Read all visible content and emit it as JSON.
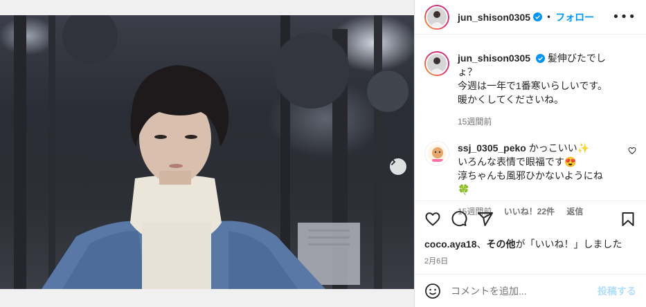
{
  "post": {
    "username": "jun_shison0305",
    "follow_label": "フォロー",
    "separator": "•",
    "more_label": "•••"
  },
  "caption": {
    "username": "jun_shison0305",
    "line1": "髪伸びたでしょ？",
    "line2": "今週は一年で1番寒いらしいです。",
    "line3": "暖かくしてくださいね。",
    "time": "15週間前"
  },
  "comment": {
    "username": "ssj_0305_peko",
    "line1": "かっこいい",
    "line1_emoji": "✨",
    "line2": "いろんな表情で眼福です",
    "line2_emoji": "😍",
    "line3": "淳ちゃんも風邪ひかないようにね",
    "line4_emoji": "🍀",
    "time": "15週間前",
    "likes": "いいね！22件",
    "reply": "返信"
  },
  "likes": {
    "user": "coco.aya18",
    "sep": "、",
    "others": "その他",
    "rest": "が「いいね！」しました"
  },
  "date": "2月6日",
  "comment_input": {
    "placeholder": "コメントを追加...",
    "post_label": "投稿する"
  },
  "carousel": {
    "total": 5,
    "active": 0
  },
  "colors": {
    "accent": "#0095f6",
    "verified": "#0095f6",
    "post_disabled": "#b2dffc"
  }
}
